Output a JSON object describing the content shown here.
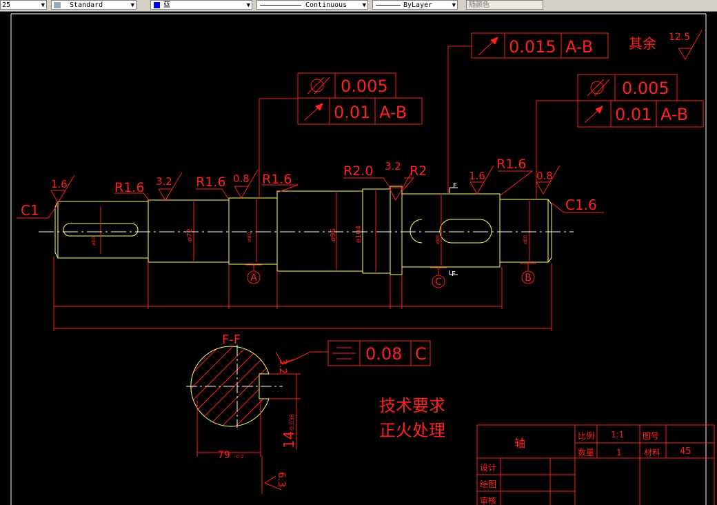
{
  "toolbar": {
    "scale_value": "25",
    "text_style": "Standard",
    "color_name": "蓝",
    "linetype": "Continuous",
    "lineweight": "ByLayer",
    "plotstyle": "随颜色"
  },
  "colors": {
    "background": "#000000",
    "geometry": "#ffff66",
    "annotation": "#ff2020",
    "border": "#ffffff",
    "centerline": "#ffffff"
  },
  "drawing": {
    "tolerance_top": {
      "symbol": "circular-runout",
      "value": "0.015",
      "datum": "A-B"
    },
    "tolerance_left": {
      "row1": {
        "symbol": "cylindricity",
        "value": "0.005"
      },
      "row2": {
        "symbol": "circular-runout",
        "value": "0.01",
        "datum": "A-B"
      }
    },
    "tolerance_right": {
      "row1": {
        "symbol": "cylindricity",
        "value": "0.005"
      },
      "row2": {
        "symbol": "circular-runout",
        "value": "0.01",
        "datum": "A-B"
      }
    },
    "tolerance_section": {
      "symbol": "symmetry",
      "value": "0.08",
      "datum": "C"
    },
    "other_roughness_label": "其余",
    "other_roughness_value": "12.5",
    "roughness": [
      "1.6",
      "3.2",
      "0.8",
      "3.2",
      "1.6",
      "0.8",
      "3.2",
      "6.3"
    ],
    "radius_labels": [
      "R1.6",
      "R1.6",
      "R1.6",
      "R2.0",
      "R2",
      "R1.6"
    ],
    "chamfer_left": "C1",
    "chamfer_right": "C1.6",
    "diameters": [
      "ø72",
      "ø96",
      "ø104"
    ],
    "datum_labels": [
      "A",
      "C",
      "B"
    ],
    "section_title": "F-F",
    "section_marker": "F",
    "section_dim_width": "79",
    "section_dim_width_tol": "-0.2",
    "section_dim_depth": "14",
    "section_dim_depth_tol": "-0.036",
    "notes_title": "技术要求",
    "notes_line1": "正火处理"
  },
  "title_block": {
    "part_name": "轴",
    "scale_label": "比例",
    "scale_value": "1:1",
    "drawing_no_label": "图号",
    "quantity_label": "数量",
    "quantity_value": "1",
    "material_label": "材料",
    "material_value": "45",
    "design_label": "设计",
    "draw_label": "绘图",
    "review_label": "审核"
  }
}
